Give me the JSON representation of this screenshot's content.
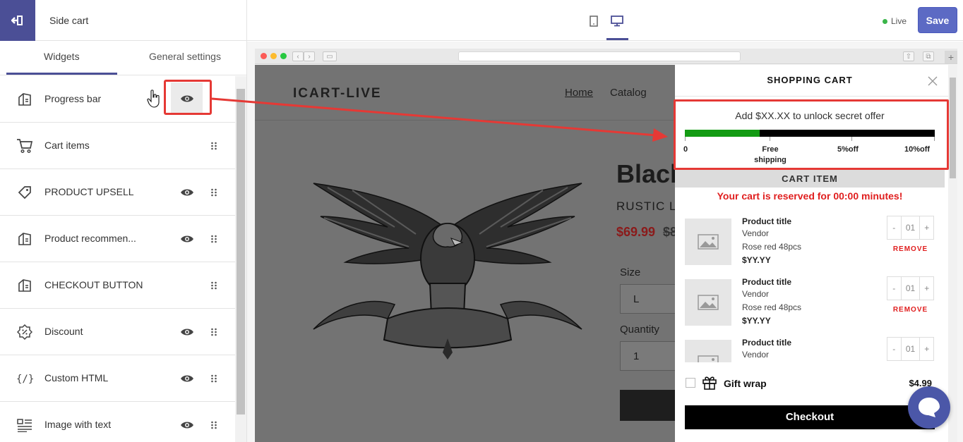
{
  "header": {
    "title": "Side cart",
    "live_label": "Live",
    "save_label": "Save",
    "live_color": "#3ab54a",
    "accent": "#4b4f96",
    "save_color": "#5c6ac4"
  },
  "tabs": [
    {
      "label": "Widgets",
      "active": true
    },
    {
      "label": "General settings",
      "active": false
    }
  ],
  "widgets": [
    {
      "label": "Progress bar",
      "icon": "widget-icon",
      "visible_toggle": true
    },
    {
      "label": "Cart items",
      "icon": "cart-icon",
      "visible_toggle": false
    },
    {
      "label": "PRODUCT UPSELL",
      "icon": "tag-icon",
      "visible_toggle": true
    },
    {
      "label": "Product recommen...",
      "icon": "widget-icon",
      "visible_toggle": true
    },
    {
      "label": "CHECKOUT BUTTON",
      "icon": "widget-icon",
      "visible_toggle": false
    },
    {
      "label": "Discount",
      "icon": "discount-icon",
      "visible_toggle": true
    },
    {
      "label": "Custom HTML",
      "icon": "code-icon",
      "visible_toggle": true
    },
    {
      "label": "Image with text",
      "icon": "image-text-icon",
      "visible_toggle": true
    }
  ],
  "store": {
    "logo": "ICART-LIVE",
    "nav": [
      "Home",
      "Catalog"
    ],
    "product_title": "Black",
    "product_subtitle": "RUSTIC L",
    "price": "$69.99",
    "old_price": "$8",
    "size_label": "Size",
    "size_value": "L",
    "quantity_label": "Quantity",
    "quantity_value": "1"
  },
  "cart": {
    "title": "SHOPPING CART",
    "offer_text": "Add $XX.XX to unlock secret offer",
    "progress": 0.3,
    "milestones": [
      {
        "label": "0"
      },
      {
        "label": "Free shipping"
      },
      {
        "label": "5%off"
      },
      {
        "label": "10%off"
      }
    ],
    "section_label": "CART ITEM",
    "reserved_text": "Your cart is reserved for 00:00 minutes!",
    "items": [
      {
        "title": "Product title",
        "vendor": "Vendor",
        "variant": "Rose red 48pcs",
        "price": "$YY.YY",
        "qty": "01",
        "remove": "REMOVE"
      },
      {
        "title": "Product title",
        "vendor": "Vendor",
        "variant": "Rose red 48pcs",
        "price": "$YY.YY",
        "qty": "01",
        "remove": "REMOVE"
      },
      {
        "title": "Product title",
        "vendor": "Vendor",
        "variant": "",
        "price": "",
        "qty": "01",
        "remove": ""
      }
    ],
    "gift_label": "Gift wrap",
    "gift_price": "$4.99",
    "checkout_label": "Checkout",
    "progress_color": "#139b13",
    "reserved_color": "#e01e1e"
  }
}
